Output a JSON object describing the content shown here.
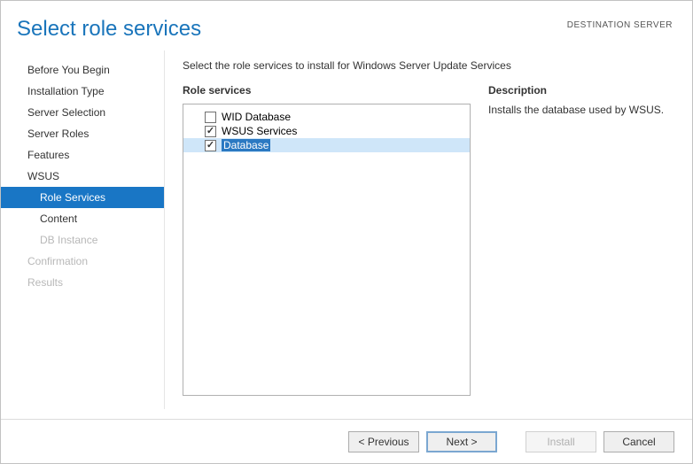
{
  "header": {
    "title": "Select role services",
    "destination_label": "DESTINATION SERVER"
  },
  "sidebar": {
    "items": [
      {
        "label": "Before You Begin",
        "state": "normal"
      },
      {
        "label": "Installation Type",
        "state": "normal"
      },
      {
        "label": "Server Selection",
        "state": "normal"
      },
      {
        "label": "Server Roles",
        "state": "normal"
      },
      {
        "label": "Features",
        "state": "normal"
      },
      {
        "label": "WSUS",
        "state": "normal"
      },
      {
        "label": "Role Services",
        "state": "selected"
      },
      {
        "label": "Content",
        "state": "sub"
      },
      {
        "label": "DB Instance",
        "state": "sub-disabled"
      },
      {
        "label": "Confirmation",
        "state": "disabled"
      },
      {
        "label": "Results",
        "state": "disabled"
      }
    ]
  },
  "main": {
    "intro": "Select the role services to install for Windows Server Update Services",
    "roles_title": "Role services",
    "roles": [
      {
        "label": "WID Database",
        "checked": false,
        "selected": false
      },
      {
        "label": "WSUS Services",
        "checked": true,
        "selected": false
      },
      {
        "label": "Database",
        "checked": true,
        "selected": true
      }
    ],
    "desc_title": "Description",
    "desc_text": "Installs the database used by WSUS."
  },
  "footer": {
    "previous": "< Previous",
    "next": "Next >",
    "install": "Install",
    "cancel": "Cancel"
  }
}
